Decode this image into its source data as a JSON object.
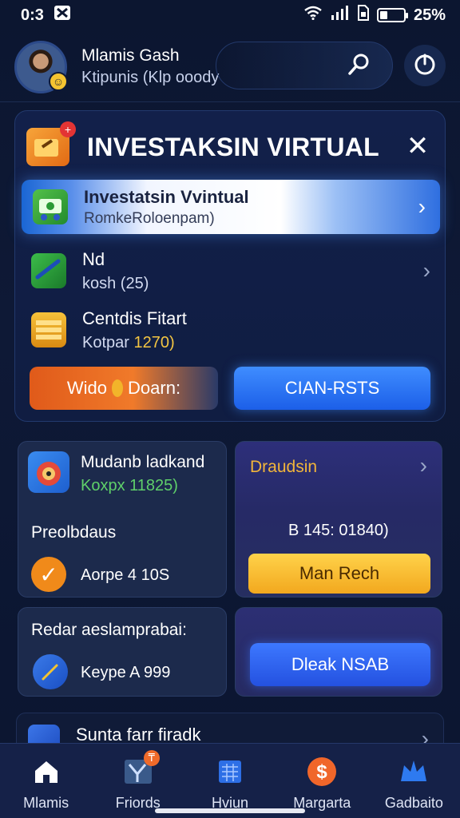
{
  "status_bar": {
    "time": "0:3",
    "battery": "25%",
    "battery_level": 0.25
  },
  "header": {
    "name": "Mlamis Gash",
    "subtitle": "Ktipunis (Klp ooody"
  },
  "card": {
    "title": "INVESTAKSIN VIRTUAL",
    "highlight": {
      "title": "Investatsin Vvintual",
      "subtitle": "RomkeRoloenpam)"
    },
    "rows": [
      {
        "title": "Nd",
        "subtitle": "kosh (25)"
      },
      {
        "title": "Centdis Fitart",
        "subtitle_prefix": "Kotpar",
        "subtitle_accent": "1270)"
      }
    ],
    "btn_orange_left": "Wido",
    "btn_orange_right": "Doarn:",
    "btn_blue": "CIAN-RSTS"
  },
  "tiles": {
    "t1": {
      "title": "Mudanb ladkand",
      "subtitle": "Koxpx 11825)",
      "label": "Preolbdaus",
      "value": "Aorpe 4 10S"
    },
    "t2": {
      "title": "Draudsin",
      "amount": "B 145: 01840)",
      "button": "Man Rech"
    },
    "t3": {
      "title": "Redar aeslamprabai:",
      "value": "Keype A 999"
    },
    "t4": {
      "button": "Dleak NSAB"
    },
    "partial": {
      "title": "Sunta farr firadk"
    }
  },
  "nav": [
    {
      "label": "Mlamis"
    },
    {
      "label": "Friords",
      "badge": "₸"
    },
    {
      "label": "Hviun"
    },
    {
      "label": "Margarta"
    },
    {
      "label": "Gadbaito"
    }
  ]
}
